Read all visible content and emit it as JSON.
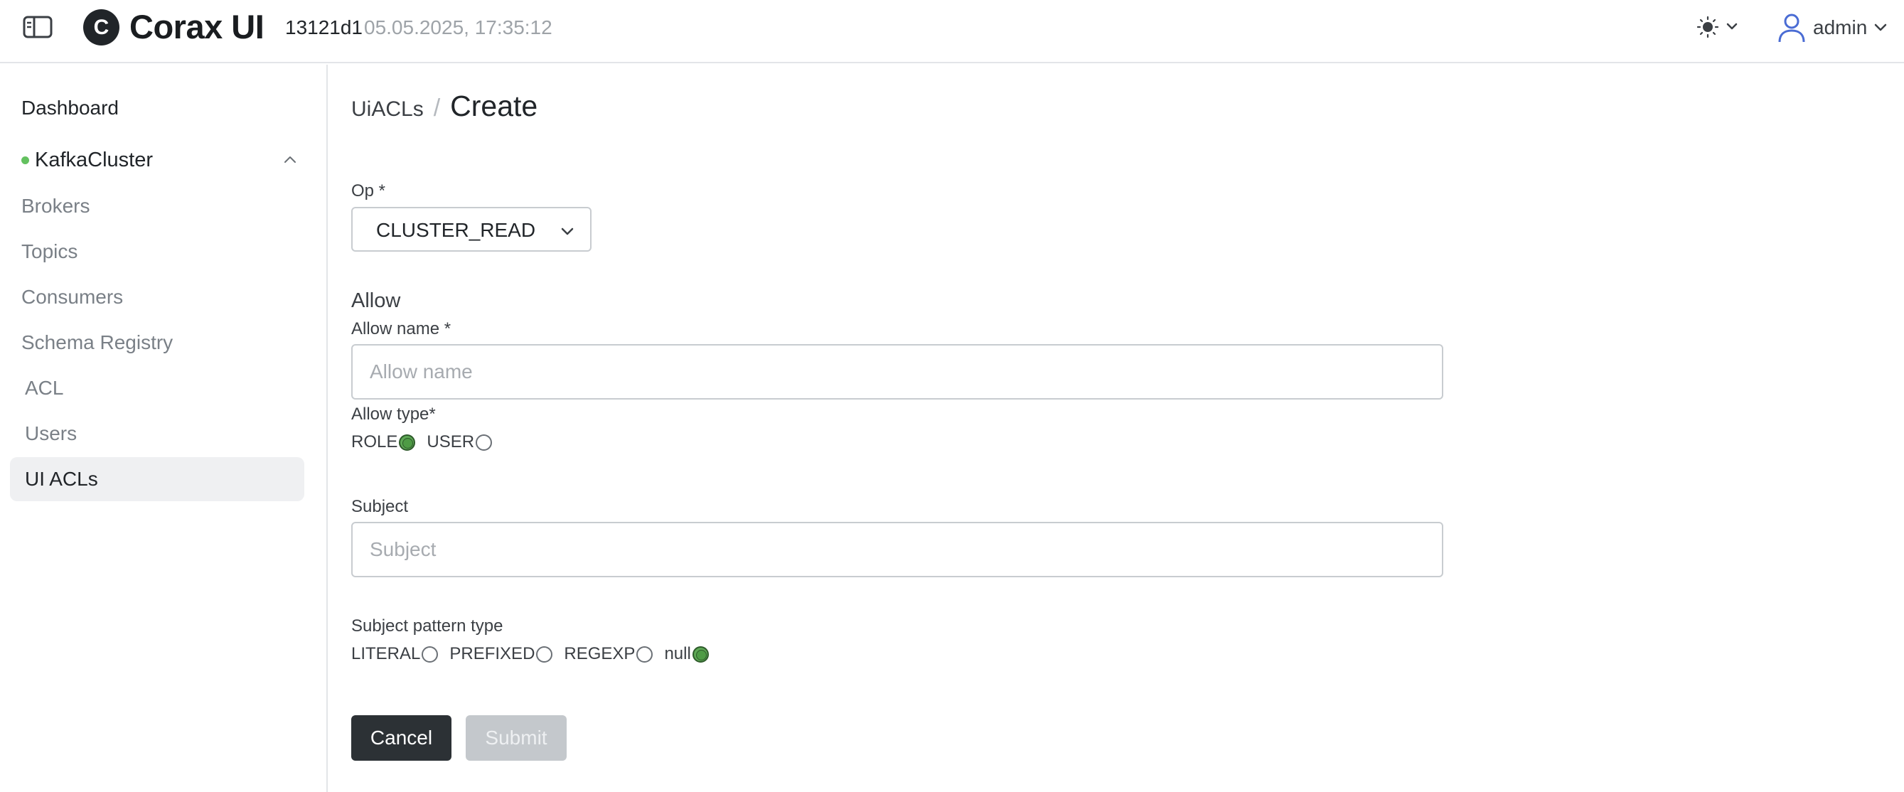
{
  "header": {
    "logo_letter": "C",
    "app_title": "Corax UI",
    "version": "13121d1",
    "build_time": "05.05.2025, 17:35:12",
    "user_name": "admin"
  },
  "sidebar": {
    "dashboard": "Dashboard",
    "cluster": {
      "name": "KafkaCluster",
      "status_color": "#63c15f",
      "expanded": true
    },
    "items": [
      {
        "label": "Brokers"
      },
      {
        "label": "Topics"
      },
      {
        "label": "Consumers"
      },
      {
        "label": "Schema Registry"
      },
      {
        "label": "ACL"
      },
      {
        "label": "Users"
      },
      {
        "label": "UI ACLs",
        "active": true
      }
    ]
  },
  "breadcrumb": {
    "parent": "UiACLs",
    "separator": "/",
    "current": "Create"
  },
  "form": {
    "op": {
      "label": "Op *",
      "value": "CLUSTER_READ"
    },
    "allow_section": "Allow",
    "allow_name": {
      "label": "Allow name *",
      "placeholder": "Allow name",
      "value": ""
    },
    "allow_type": {
      "label": "Allow type*",
      "options": [
        {
          "label": "ROLE",
          "checked": true
        },
        {
          "label": "USER",
          "checked": false
        }
      ]
    },
    "subject": {
      "label": "Subject",
      "placeholder": "Subject",
      "value": ""
    },
    "subject_pattern_type": {
      "label": "Subject pattern type",
      "options": [
        {
          "label": "LITERAL",
          "checked": false
        },
        {
          "label": "PREFIXED",
          "checked": false
        },
        {
          "label": "REGEXP",
          "checked": false
        },
        {
          "label": "null",
          "checked": true
        }
      ]
    },
    "cancel_label": "Cancel",
    "submit_label": "Submit",
    "submit_disabled": true
  },
  "colors": {
    "primary_dark": "#2c3135",
    "radio_checked": "#5ea855",
    "status_online": "#63c15f",
    "user_icon": "#4a6cd4"
  },
  "icons": {
    "sidebar_toggle": "sidebar-toggle-icon",
    "theme": "sun-icon",
    "user": "user-icon",
    "chevron": "chevron-down-icon"
  }
}
